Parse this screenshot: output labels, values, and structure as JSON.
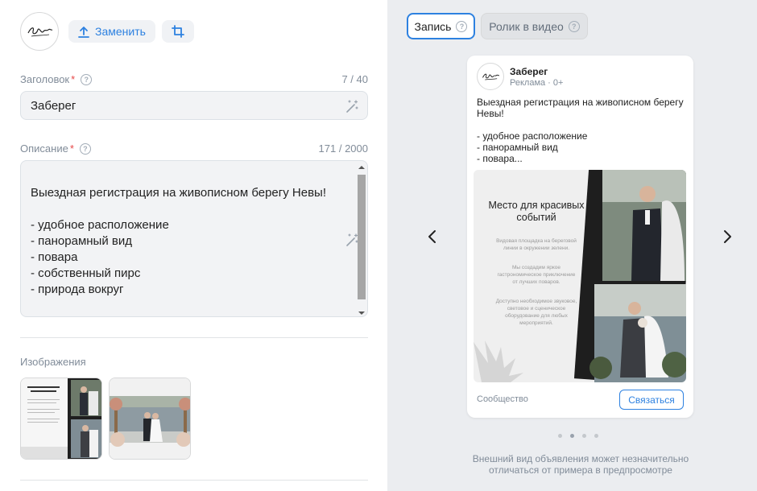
{
  "avatar": {
    "logo_text": "Заберег"
  },
  "toolbar": {
    "replace_label": "Заменить"
  },
  "headline": {
    "label": "Заголовок",
    "required_mark": "*",
    "counter": "7 / 40",
    "value": "Заберег"
  },
  "description": {
    "label": "Описание",
    "required_mark": "*",
    "counter": "171 / 2000",
    "value": "Выездная регистрация на живописном берегу Невы!\n\n- удобное расположение\n- панорамный вид\n- повара\n- собственный пирс\n- природа вокруг\n\nВсе это и больше вы получите у нас."
  },
  "images": {
    "label": "Изображения"
  },
  "preview": {
    "tabs": [
      {
        "label": "Запись",
        "active": true
      },
      {
        "label": "Ролик в видео",
        "active": false
      }
    ],
    "card": {
      "name": "Заберег",
      "meta": "Реклама · 0+",
      "text": "Выездная регистрация на живописном берегу Невы!\n\n- удобное расположение\n- панорамный вид\n- повара...",
      "image_title": "Место для красивых событий",
      "image_lines": [
        "Видовая площадка на береговой линии в окружении зелени.",
        "Мы создадим яркое гастрономическое приключение от лучших поваров.",
        "Доступно необходимое звуковое, световое и сценическое оборудование для любых мероприятий."
      ],
      "community_label": "Сообщество",
      "contact_label": "Связаться"
    },
    "carousel": {
      "total": 4,
      "active_index": 1
    },
    "footnote": "Внешний вид объявления может незначительно отличаться от примера в предпросмотре"
  },
  "colors": {
    "accent": "#2d81e0",
    "panel_bg": "#ebedf0",
    "required": "#e64646"
  }
}
